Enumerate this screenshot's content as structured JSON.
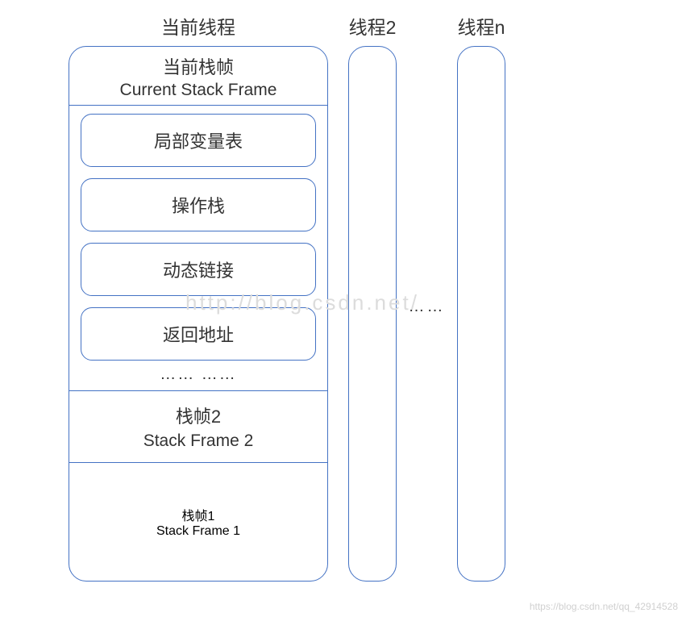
{
  "threads": {
    "current": {
      "title": "当前线程",
      "currentFrame": {
        "cn": "当前栈帧",
        "en": "Current Stack Frame"
      },
      "innerBoxes": [
        "局部变量表",
        "操作栈",
        "动态链接",
        "返回地址"
      ],
      "innerEllipsis": "…… ……",
      "frame2": {
        "cn": "栈帧2",
        "en": "Stack Frame 2"
      },
      "frame1": {
        "cn": "栈帧1",
        "en": "Stack Frame 1"
      }
    },
    "thread2": {
      "title": "线程2"
    },
    "threadN": {
      "title": "线程n"
    }
  },
  "betweenDots": "……",
  "watermark": "http://blog.csdn.net/",
  "credit": "https://blog.csdn.net/qq_42914528"
}
